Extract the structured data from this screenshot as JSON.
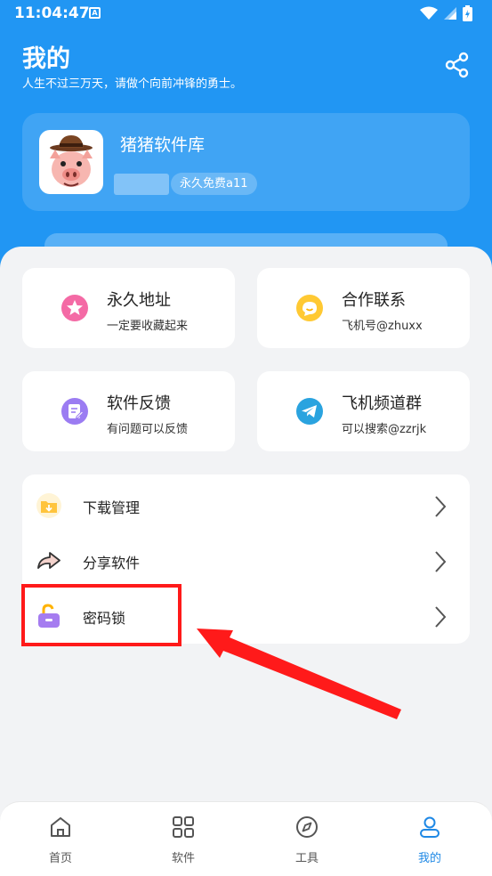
{
  "status_bar": {
    "time": "11:04:47",
    "badge": "A"
  },
  "header": {
    "title": "我的",
    "subtitle": "人生不过三万天，请做个向前冲锋的勇士。"
  },
  "profile": {
    "name": "猪猪软件库",
    "tag": "永久免费a11"
  },
  "grid": [
    {
      "title": "永久地址",
      "desc": "一定要收藏起来",
      "icon": "star-icon"
    },
    {
      "title": "合作联系",
      "desc": "飞机号@zhuxx",
      "icon": "chat-icon"
    },
    {
      "title": "软件反馈",
      "desc": "有问题可以反馈",
      "icon": "feedback-icon"
    },
    {
      "title": "飞机频道群",
      "desc": "可以搜索@zzrjk",
      "icon": "telegram-icon"
    }
  ],
  "menu": [
    {
      "label": "下载管理",
      "icon": "download-folder-icon"
    },
    {
      "label": "分享软件",
      "icon": "share-arrow-icon"
    },
    {
      "label": "密码锁",
      "icon": "unlock-icon"
    }
  ],
  "nav": [
    {
      "label": "首页",
      "icon": "home-icon"
    },
    {
      "label": "软件",
      "icon": "grid-icon"
    },
    {
      "label": "工具",
      "icon": "compass-icon"
    },
    {
      "label": "我的",
      "icon": "user-icon",
      "active": true
    }
  ],
  "colors": {
    "primary": "#2196f3",
    "accent_active": "#1e88e5",
    "annotation_red": "#ff1a1a"
  }
}
